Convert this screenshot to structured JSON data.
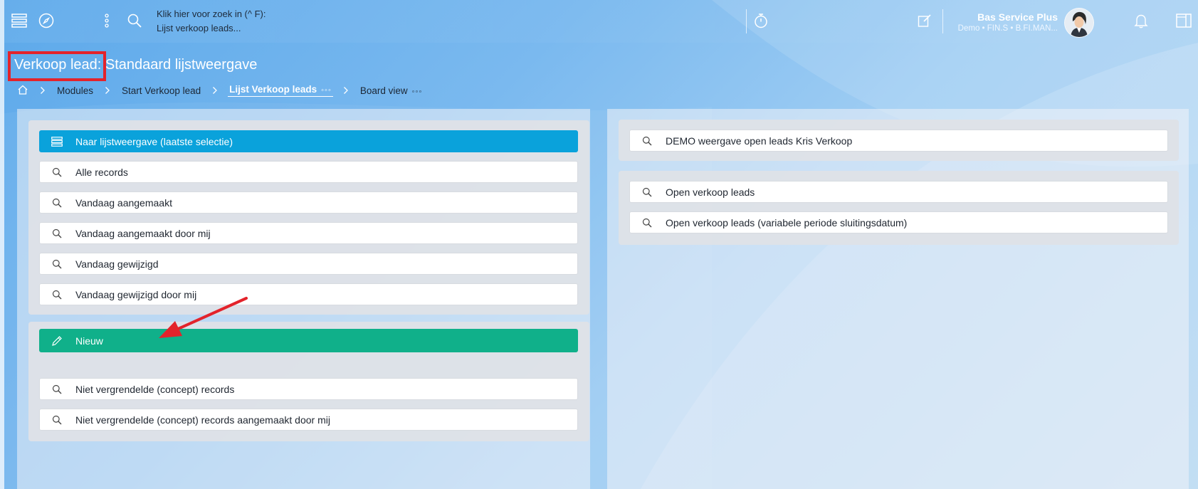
{
  "topbar": {
    "search_hint_line1": "Klik hier voor zoek in (^ F):",
    "search_hint_line2": "Lijst verkoop leads...",
    "user_name": "Bas Service Plus",
    "user_sub": "Demo • FIN.S • B.FI.MAN..."
  },
  "page": {
    "title": "Verkoop lead: Standaard lijstweergave"
  },
  "breadcrumb": {
    "modules": "Modules",
    "start": "Start Verkoop lead",
    "list": "Lijst Verkoop leads",
    "list_more": "◦◦◦",
    "board": "Board view",
    "board_more": "◦◦◦"
  },
  "left": {
    "primary": "Naar lijstweergave (laatste selectie)",
    "items": [
      "Alle records",
      "Vandaag aangemaakt",
      "Vandaag aangemaakt door mij",
      "Vandaag gewijzigd",
      "Vandaag gewijzigd door mij"
    ],
    "new_button": "Nieuw",
    "concept_items": [
      "Niet vergrendelde (concept) records",
      "Niet vergrendelde (concept) records aangemaakt door mij"
    ]
  },
  "right": {
    "demo_item": "DEMO weergave open leads Kris Verkoop",
    "items": [
      "Open verkoop leads",
      "Open verkoop leads (variabele periode sluitingsdatum)"
    ]
  },
  "colors": {
    "primary_blue": "#0aa2db",
    "new_green": "#10b08a",
    "highlight_red": "#e3232b"
  }
}
